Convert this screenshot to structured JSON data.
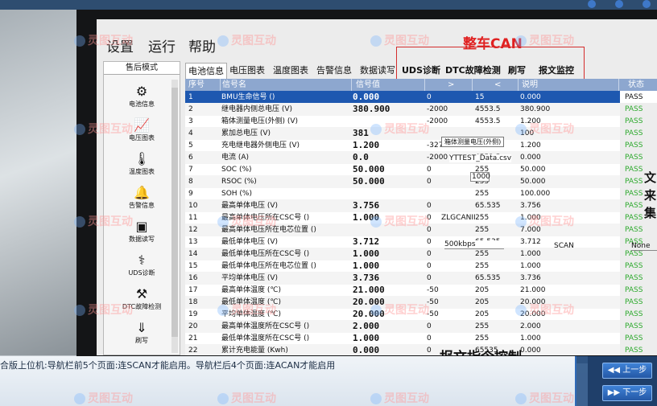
{
  "menu": {
    "settings": "设置",
    "run": "运行",
    "help": "帮助",
    "vehicle_can": "整车CAN"
  },
  "sidebar": {
    "title": "售后模式",
    "items": [
      {
        "label": "电池信息",
        "icon": "battery-info-icon"
      },
      {
        "label": "电压图表",
        "icon": "voltage-chart-icon"
      },
      {
        "label": "温度图表",
        "icon": "thermometer-icon"
      },
      {
        "label": "告警信息",
        "icon": "bell-icon"
      },
      {
        "label": "数据读写",
        "icon": "monitor-chart-icon"
      },
      {
        "label": "UDS诊断",
        "icon": "uds-diagnosis-icon"
      },
      {
        "label": "DTC故障检测",
        "icon": "dtc-fault-icon"
      },
      {
        "label": "刷写",
        "icon": "download-icon"
      }
    ]
  },
  "tabs": [
    "电池信息",
    "电压图表",
    "温度图表",
    "告警信息",
    "数据读写",
    "UDS诊断",
    "DTC故障检测",
    "刷写",
    "报文监控"
  ],
  "table": {
    "headers": {
      "idx": "序号",
      "name": "信号名",
      "val": "信号值",
      "max": ">",
      "min": "<",
      "desc": "说明",
      "stat": "状态"
    },
    "rows": [
      [
        "1",
        "BMU生命信号 ()",
        "0.000",
        "0",
        "15",
        "0.000",
        "PASS"
      ],
      [
        "2",
        "继电器内侧总电压 (V)",
        "380.900",
        "-2000",
        "4553.5",
        "380.900",
        "PASS"
      ],
      [
        "3",
        "箱体测量电压(外侧) (V)",
        "",
        "-2000",
        "4553.5",
        "1.200",
        "PASS"
      ],
      [
        "4",
        "累加总电压 (V)",
        "381",
        "",
        "",
        "100",
        "PASS"
      ],
      [
        "5",
        "充电继电器外侧电压 (V)",
        "1.200",
        "-3276.8",
        "3000",
        "1.200",
        "PASS"
      ],
      [
        "6",
        "电流 (A)",
        "0.0",
        "-2000",
        "4553.5",
        "0.000",
        "PASS"
      ],
      [
        "7",
        "SOC (%)",
        "50.000",
        "0",
        "255",
        "50.000",
        "PASS"
      ],
      [
        "8",
        "RSOC (%)",
        "50.000",
        "0",
        "255",
        "50.000",
        "PASS"
      ],
      [
        "9",
        "SOH (%)",
        "",
        "",
        "255",
        "100.000",
        "PASS"
      ],
      [
        "10",
        "最高单体电压 (V)",
        "3.756",
        "0",
        "65.535",
        "3.756",
        "PASS"
      ],
      [
        "11",
        "最高单体电压所在CSC号 ()",
        "1.000",
        "0",
        "255",
        "1.000",
        "PASS"
      ],
      [
        "12",
        "最高单体电压所在电芯位置 ()",
        "",
        "0",
        "255",
        "7.000",
        "PASS"
      ],
      [
        "13",
        "最低单体电压 (V)",
        "3.712",
        "0",
        "65.535",
        "3.712",
        "PASS"
      ],
      [
        "14",
        "最低单体电压所在CSC号 ()",
        "1.000",
        "0",
        "255",
        "1.000",
        "PASS"
      ],
      [
        "15",
        "最低单体电压所在电芯位置 ()",
        "1.000",
        "0",
        "255",
        "1.000",
        "PASS"
      ],
      [
        "16",
        "平均单体电压 (V)",
        "3.736",
        "0",
        "65.535",
        "3.736",
        "PASS"
      ],
      [
        "17",
        "最高单体温度 (℃)",
        "21.000",
        "-50",
        "205",
        "21.000",
        "PASS"
      ],
      [
        "18",
        "最低单体温度 (℃)",
        "20.000",
        "-50",
        "205",
        "20.000",
        "PASS"
      ],
      [
        "19",
        "平均单体温度 (℃)",
        "20.000",
        "-50",
        "205",
        "20.000",
        "PASS"
      ],
      [
        "20",
        "最高单体温度所在CSC号 ()",
        "2.000",
        "0",
        "255",
        "2.000",
        "PASS"
      ],
      [
        "21",
        "最低单体温度所在CSC号 ()",
        "1.000",
        "0",
        "255",
        "1.000",
        "PASS"
      ],
      [
        "22",
        "累计充电能量 (Kwh)",
        "0.000",
        "0",
        "65535",
        "0.000",
        "PASS"
      ],
      [
        "23",
        "累计放电能量 (Kwh)",
        "0.000",
        "0",
        "65535",
        "",
        "PASS"
      ]
    ]
  },
  "overlays": {
    "tooltip": "箱体测量电压(外侧)",
    "filename": "YTTEST_Data.csv",
    "small_input": "1000",
    "zlgcan": "ZLGCANII",
    "baud": "500kbps",
    "scan": "SCAN",
    "none": "None",
    "cmd_title": "报文指令控制"
  },
  "right_edge": [
    "文",
    "来",
    "集"
  ],
  "instruction": "合版上位机:导航栏前5个页面:连SCAN才能启用。导航栏后4个页面:连ACAN才能启用",
  "nav": {
    "prev": "上一步",
    "next": "下一步"
  },
  "watermark": "灵图互动"
}
